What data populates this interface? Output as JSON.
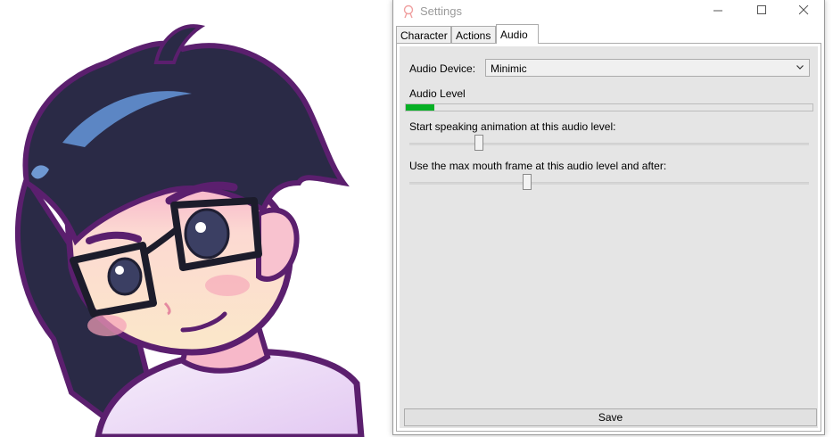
{
  "window": {
    "title": "Settings",
    "controls": {
      "minimize": "minimize-icon",
      "maximize": "maximize-icon",
      "close": "close-icon"
    }
  },
  "tabs": [
    {
      "label": "Character",
      "active": false
    },
    {
      "label": "Actions",
      "active": false
    },
    {
      "label": "Audio",
      "active": true
    }
  ],
  "audio": {
    "device_label": "Audio Device:",
    "device_value": "Minimic",
    "level_label": "Audio Level",
    "level_fraction": 0.07,
    "start_label": "Start speaking animation at this audio level:",
    "start_value_fraction": 0.175,
    "max_label": "Use the max mouth frame at this audio level and after:",
    "max_value_fraction": 0.295
  },
  "save_label": "Save",
  "colors": {
    "progress_fill": "#06b025",
    "panel_bg": "#e5e5e5",
    "hair": "#2a2a46",
    "hair_highlight": "#5c86c4",
    "skin": "#fbe3cc",
    "outline": "#5b1f6e"
  }
}
